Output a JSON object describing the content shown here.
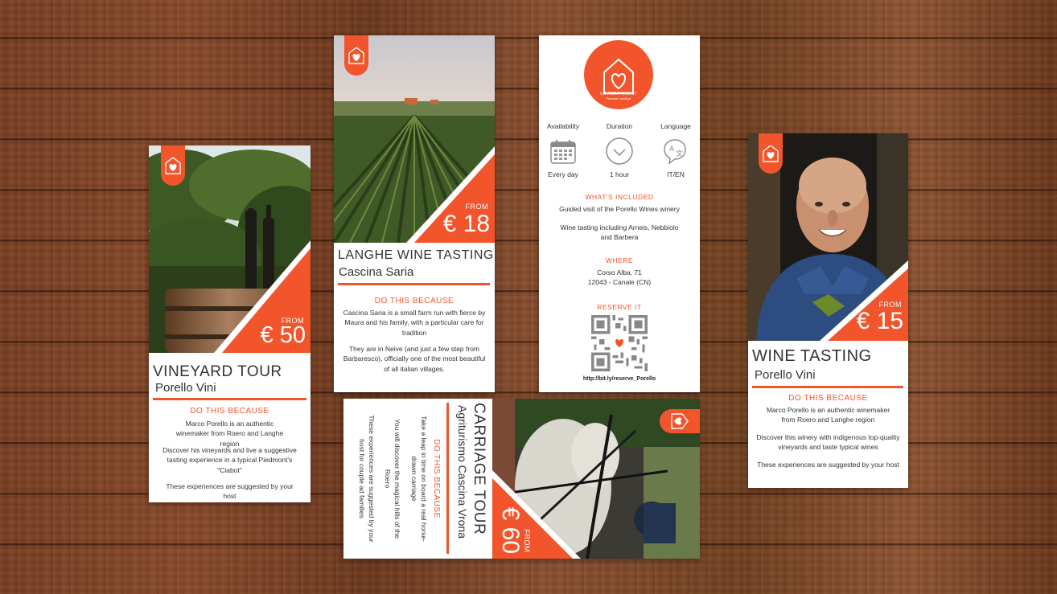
{
  "colors": {
    "accent": "#f2552c",
    "wood": "#7a3f22",
    "card": "#ffffff"
  },
  "card_vineyard": {
    "from": "FROM",
    "price": "€ 50",
    "title": "VINEYARD TOUR",
    "subtitle": "Porello Vini",
    "section": "DO THIS BECAUSE",
    "p1": "Marco Porello is an authentic winemaker from Roero and Langhe region",
    "p2": "Discover his vineyards and live a suggestive tasting experience in a typical Piedmont's \"Ciabot\"",
    "p3": "These experiences are suggested by your host"
  },
  "card_langhe": {
    "from": "FROM",
    "price": "€ 18",
    "title": "LANGHE WINE TASTING",
    "subtitle": "Cascina Saria",
    "section": "DO THIS BECAUSE",
    "p1": "Cascina Saria is a small farm run with fierce by Maura and his family, with a particular care for tradition",
    "p2": "They are in Neive (and just a few step from Barbaresco), officially one of the most beautiful of all italian villages."
  },
  "card_info": {
    "logo_text": "LOVESMYGUEST",
    "logo_sub": "Personal Concierge",
    "availability_label": "Availability",
    "availability_value": "Every day",
    "availability_icon": "calendar-icon",
    "duration_label": "Duration",
    "duration_value": "1 hour",
    "duration_icon": "check-circle-icon",
    "language_label": "Language",
    "language_value": "IT/EN",
    "language_icon": "translate-icon",
    "included_title": "WHAT'S INCLUDED",
    "included_1": "Guided visit of the Porello Wines winery",
    "included_2": "Wine tasting including Arneis, Nebbiolo and Barbera",
    "where_title": "WHERE",
    "where_1": "Corso Alba, 71",
    "where_2": "12043 - Canale (CN)",
    "reserve_title": "RESERVE IT",
    "reserve_link": "http://bit.ly/reserve_Porello"
  },
  "card_wine": {
    "from": "FROM",
    "price": "€ 15",
    "title": "WINE TASTING",
    "subtitle": "Porello Vini",
    "section": "DO THIS BECAUSE",
    "p1": "Marco Porello is an authentic winemaker from Roero and Langhe region",
    "p2": "Discover this winery with indigenous top-quality vineyards and taste typical wines",
    "p3": "These experiences are suggested by your host"
  },
  "card_carriage": {
    "from": "FROM",
    "price": "€ 60",
    "title": "CARRIAGE TOUR",
    "subtitle": "Agriturismo Cascina Vrona",
    "section": "DO THIS BECAUSE",
    "p1": "Take a leap in time on board a real horse-drawn carriage",
    "p2": "You will discover the magical hills of the Roero",
    "p3": "These experiences are suggested by your host for couple ad families"
  }
}
